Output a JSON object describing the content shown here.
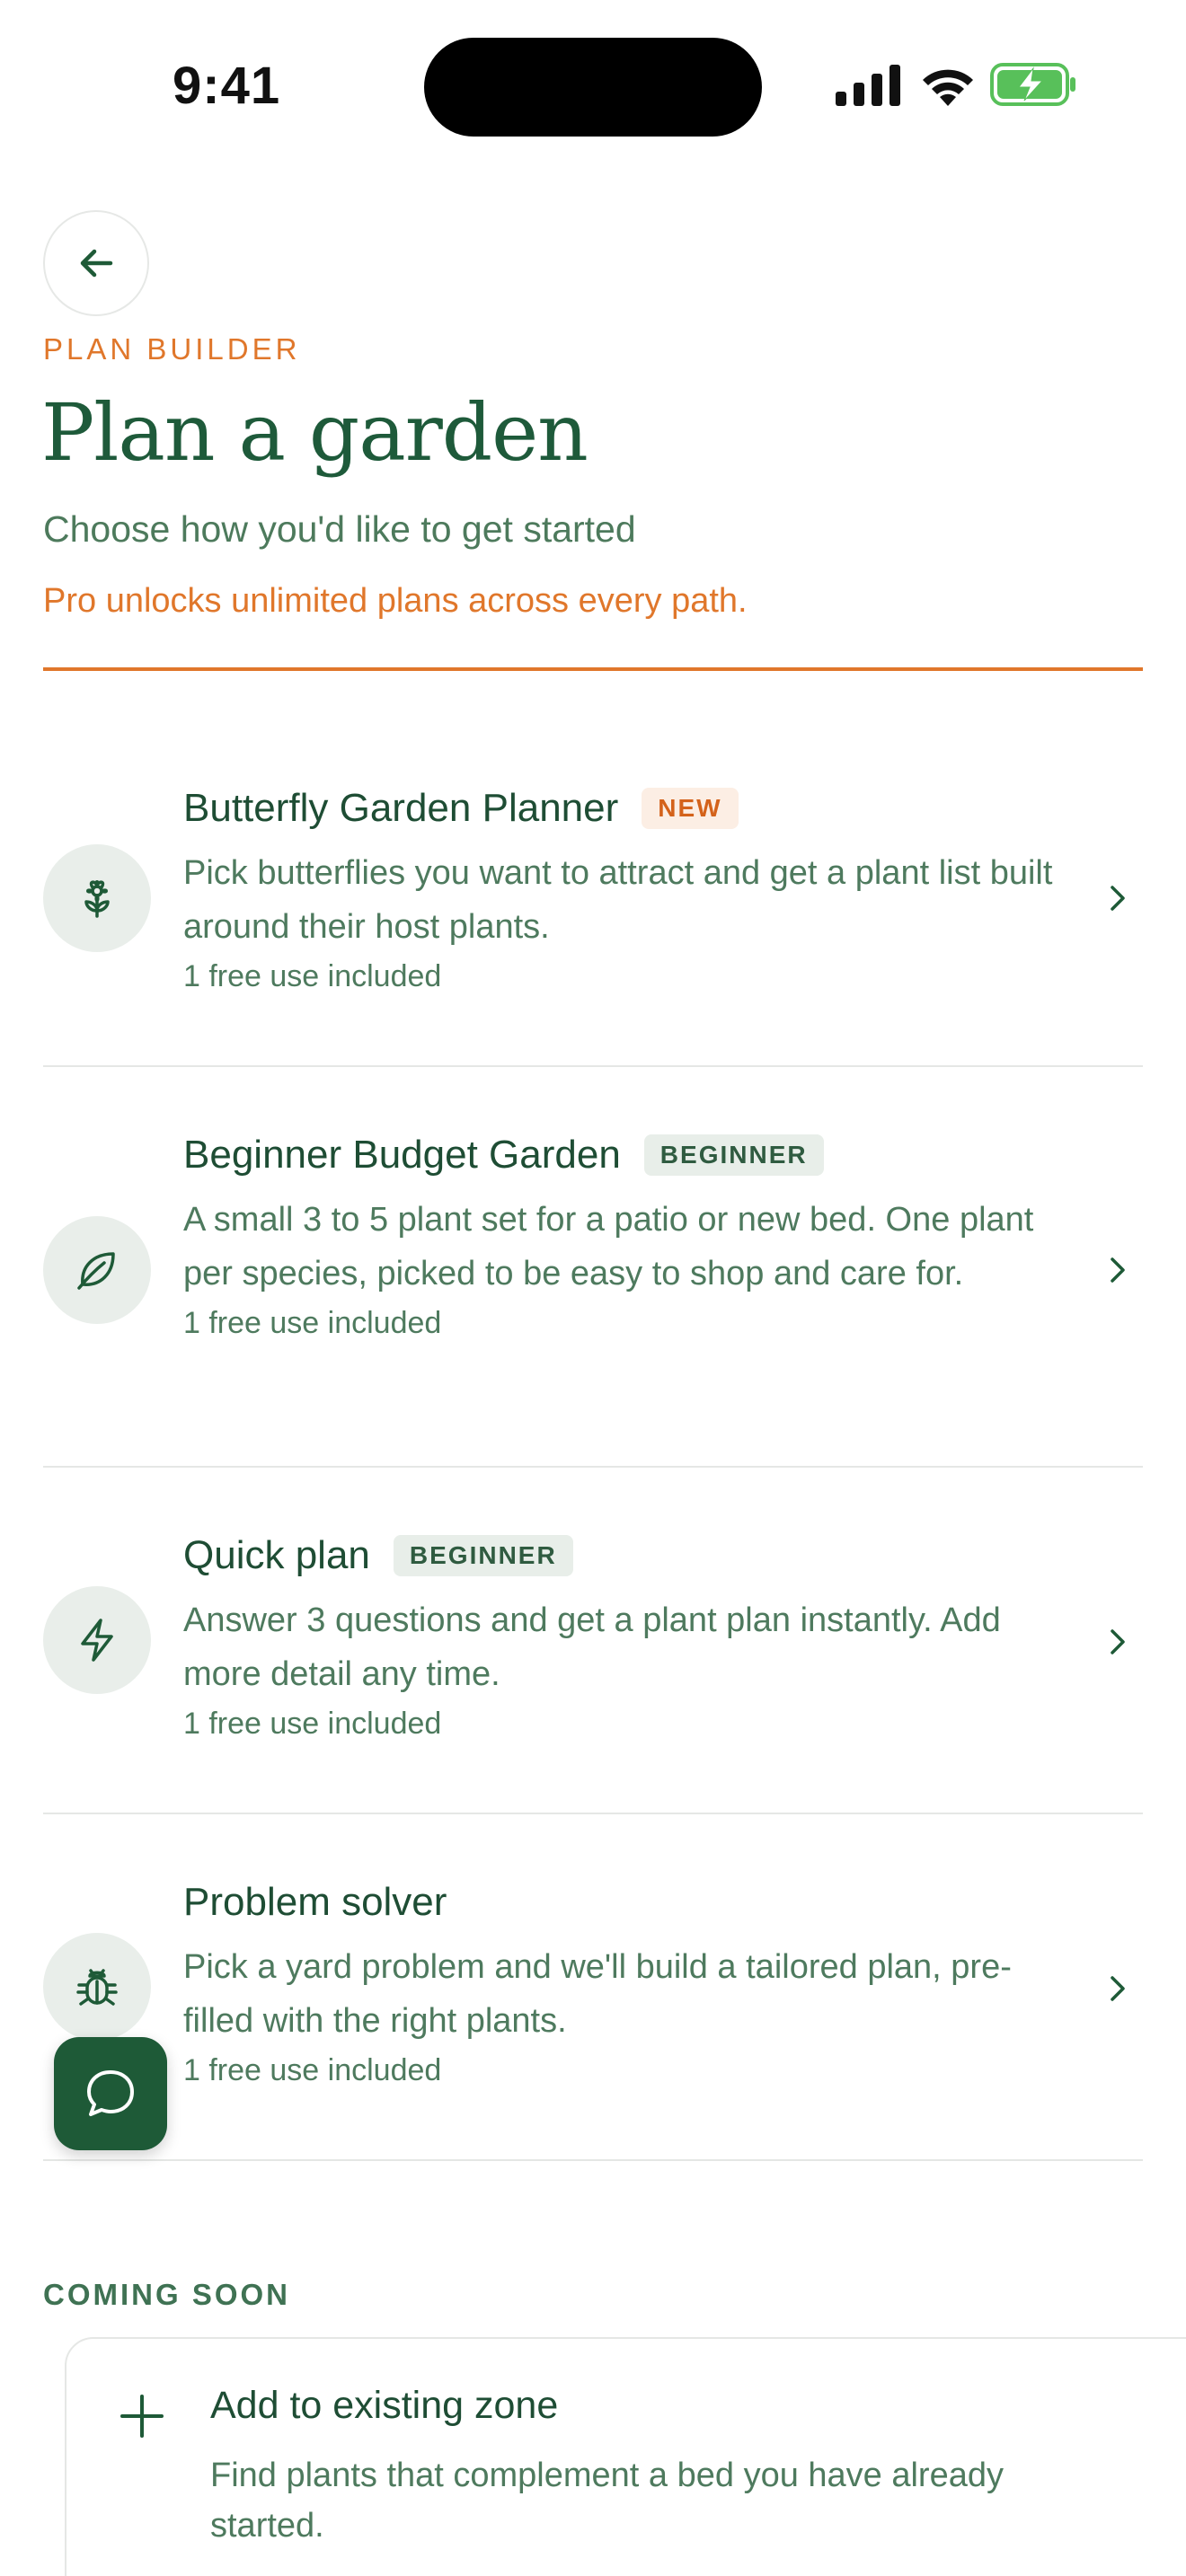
{
  "status_bar": {
    "time": "9:41"
  },
  "header": {
    "eyebrow": "PLAN BUILDER",
    "title": "Plan a garden",
    "subtitle": "Choose how you'd like to get started",
    "promo": "Pro unlocks unlimited plans across every path."
  },
  "options": [
    {
      "title": "Butterfly Garden Planner",
      "badge": "NEW",
      "description": "Pick butterflies you want to attract and get a plant list built around their host plants.",
      "meta": "1 free use included",
      "icon": "flower-icon"
    },
    {
      "title": "Beginner Budget Garden",
      "badge": "BEGINNER",
      "description": "A small 3 to 5 plant set for a patio or new bed. One plant per species, picked to be easy to shop and care for.",
      "meta": "1 free use included",
      "icon": "leaf-icon"
    },
    {
      "title": "Quick plan",
      "badge": "BEGINNER",
      "description": "Answer 3 questions and get a plant plan instantly. Add more detail any time.",
      "meta": "1 free use included",
      "icon": "lightning-icon"
    },
    {
      "title": "Problem solver",
      "badge": "",
      "description": "Pick a yard problem and we'll build a tailored plan, pre-filled with the right plants.",
      "meta": "1 free use included",
      "icon": "bug-icon"
    }
  ],
  "coming_soon": {
    "label": "COMING SOON",
    "items": [
      {
        "title": "Add to existing zone",
        "description": "Find plants that complement a bed you have already started."
      }
    ]
  },
  "colors": {
    "primary": "#1E5A37",
    "accent": "#E0772B",
    "muted_text": "#4E7A5E",
    "icon_bg": "#E9EEEA"
  }
}
